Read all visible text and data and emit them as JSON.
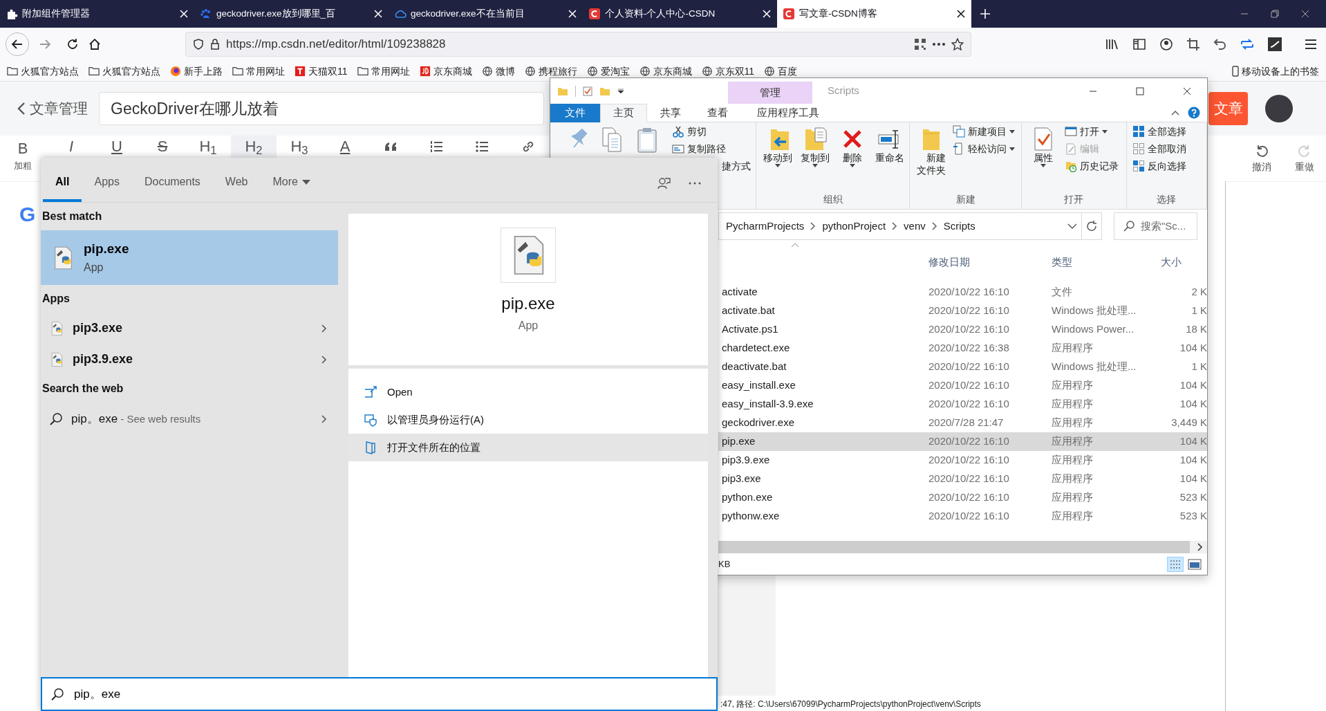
{
  "browser": {
    "tabs": [
      {
        "title": "附加组件管理器",
        "selected": false
      },
      {
        "title": "geckodriver.exe放到哪里_百",
        "selected": false
      },
      {
        "title": "geckodriver.exe不在当前目",
        "selected": false
      },
      {
        "title": "个人资料-个人中心-CSDN",
        "selected": false
      },
      {
        "title": "写文章-CSDN博客",
        "selected": true
      }
    ],
    "url": "https://mp.csdn.net/editor/html/109238828",
    "bookmarks": [
      "火狐官方站点",
      "火狐官方站点",
      "新手上路",
      "常用网址",
      "天猫双11",
      "常用网址",
      "京东商城",
      "微博",
      "携程旅行",
      "爱淘宝",
      "京东商城",
      "京东双11",
      "百度"
    ],
    "mobile_bookmarks": "移动设备上的书签"
  },
  "editor": {
    "back": "文章管理",
    "title": "GeckoDriver在哪儿放着",
    "tools": [
      {
        "glyph": "B",
        "label": "加粗",
        "selected": false
      },
      {
        "glyph": "I",
        "selected": false
      },
      {
        "glyph": "U",
        "selected": false
      },
      {
        "glyph": "S",
        "selected": false
      },
      {
        "glyph": "H$_{1}$",
        "selected": false
      },
      {
        "glyph": "H$_{2}$",
        "selected": true
      },
      {
        "glyph": "H$_{3}$",
        "selected": false
      },
      {
        "glyph": "A",
        "selected": false
      }
    ],
    "publish": "文章",
    "undo": "撤消",
    "redo": "重做",
    "content": "G"
  },
  "back_window": {
    "status": ":47, 路径: C:\\Users\\67099\\PycharmProjects\\pythonProject\\venv\\Scripts"
  },
  "explorer": {
    "title": "Scripts",
    "context_tab": "管理",
    "ribbon_tabs": [
      {
        "label": "文件",
        "kind": "file",
        "selected": false
      },
      {
        "label": "主页",
        "kind": "tab",
        "selected": true
      },
      {
        "label": "共享",
        "kind": "tab",
        "selected": false
      },
      {
        "label": "查看",
        "kind": "tab",
        "selected": false
      },
      {
        "label": "应用程序工具",
        "kind": "tab",
        "selected": false
      }
    ],
    "ribbon_groups": [
      {
        "kind": "clipboard",
        "small": [
          {
            "label": "剪切",
            "dropdown": false,
            "disabled": false
          },
          {
            "label": "复制路径",
            "dropdown": false,
            "disabled": false
          },
          {
            "label": "捷方式",
            "dropdown": false,
            "disabled": false
          }
        ]
      },
      {
        "kind": "standard",
        "label": "组织",
        "large": [
          {
            "label": "移动到",
            "dropdown": true
          },
          {
            "label": "复制到",
            "dropdown": true
          },
          {
            "label": "删除",
            "dropdown": true
          },
          {
            "label": "重命名",
            "dropdown": false
          }
        ]
      },
      {
        "kind": "standard",
        "label": "新建",
        "large": [
          {
            "label": "新建文件夹",
            "dropdown": false
          }
        ],
        "small": [
          {
            "label": "新建项目",
            "dropdown": true,
            "disabled": false
          },
          {
            "label": "轻松访问",
            "dropdown": true,
            "disabled": false
          }
        ]
      },
      {
        "kind": "standard",
        "label": "打开",
        "large": [
          {
            "label": "属性",
            "dropdown": true
          }
        ],
        "small": [
          {
            "label": "打开",
            "dropdown": true,
            "disabled": false
          },
          {
            "label": "编辑",
            "dropdown": false,
            "disabled": true
          },
          {
            "label": "历史记录",
            "dropdown": false,
            "disabled": false
          }
        ]
      },
      {
        "kind": "standard",
        "label": "选择",
        "small": [
          {
            "label": "全部选择",
            "dropdown": false,
            "disabled": false
          },
          {
            "label": "全部取消",
            "dropdown": false,
            "disabled": false
          },
          {
            "label": "反向选择",
            "dropdown": false,
            "disabled": false
          }
        ]
      }
    ],
    "breadcrumb": [
      "PycharmProjects",
      "pythonProject",
      "venv",
      "Scripts"
    ],
    "search": {
      "placeholder": "搜索\"Sc..."
    },
    "columns": [
      "修改日期",
      "类型",
      "大小"
    ],
    "rows": [
      {
        "name": "activate",
        "date": "2020/10/22 16:10",
        "type": "文件",
        "size": "2 K",
        "selected": false
      },
      {
        "name": "activate.bat",
        "date": "2020/10/22 16:10",
        "type": "Windows 批处理...",
        "size": "1 K",
        "selected": false
      },
      {
        "name": "Activate.ps1",
        "date": "2020/10/22 16:10",
        "type": "Windows Power...",
        "size": "18 K",
        "selected": false
      },
      {
        "name": "chardetect.exe",
        "date": "2020/10/22 16:38",
        "type": "应用程序",
        "size": "104 K",
        "selected": false
      },
      {
        "name": "deactivate.bat",
        "date": "2020/10/22 16:10",
        "type": "Windows 批处理...",
        "size": "1 K",
        "selected": false
      },
      {
        "name": "easy_install.exe",
        "date": "2020/10/22 16:10",
        "type": "应用程序",
        "size": "104 K",
        "selected": false
      },
      {
        "name": "easy_install-3.9.exe",
        "date": "2020/10/22 16:10",
        "type": "应用程序",
        "size": "104 K",
        "selected": false
      },
      {
        "name": "geckodriver.exe",
        "date": "2020/7/28 21:47",
        "type": "应用程序",
        "size": "3,449 K",
        "selected": false
      },
      {
        "name": "pip.exe",
        "date": "2020/10/22 16:10",
        "type": "应用程序",
        "size": "104 K",
        "selected": true
      },
      {
        "name": "pip3.9.exe",
        "date": "2020/10/22 16:10",
        "type": "应用程序",
        "size": "104 K",
        "selected": false
      },
      {
        "name": "pip3.exe",
        "date": "2020/10/22 16:10",
        "type": "应用程序",
        "size": "104 K",
        "selected": false
      },
      {
        "name": "python.exe",
        "date": "2020/10/22 16:10",
        "type": "应用程序",
        "size": "523 K",
        "selected": false
      },
      {
        "name": "pythonw.exe",
        "date": "2020/10/22 16:10",
        "type": "应用程序",
        "size": "523 K",
        "selected": false
      }
    ],
    "status": "KB"
  },
  "start_search": {
    "tabs": [
      {
        "label": "All",
        "selected": true,
        "dropdown": false
      },
      {
        "label": "Apps",
        "selected": false,
        "dropdown": false
      },
      {
        "label": "Documents",
        "selected": false,
        "dropdown": false
      },
      {
        "label": "Web",
        "selected": false,
        "dropdown": false
      },
      {
        "label": "More",
        "selected": false,
        "dropdown": true
      }
    ],
    "best_match_heading": "Best match",
    "best_match": {
      "name": "pip.exe",
      "type": "App",
      "selected": true
    },
    "apps_heading": "Apps",
    "apps": [
      {
        "name": "pip3.exe"
      },
      {
        "name": "pip3.9.exe"
      }
    ],
    "web_heading": "Search the web",
    "web": {
      "query": "pip。exe",
      "hint": " - See web results"
    },
    "preview": {
      "name": "pip.exe",
      "type": "App",
      "actions": [
        {
          "label": "Open",
          "selected": false
        },
        {
          "label": "以管理员身份运行(A)",
          "selected": false
        },
        {
          "label": "打开文件所在的位置",
          "selected": true
        }
      ]
    },
    "query": "pip。exe"
  }
}
